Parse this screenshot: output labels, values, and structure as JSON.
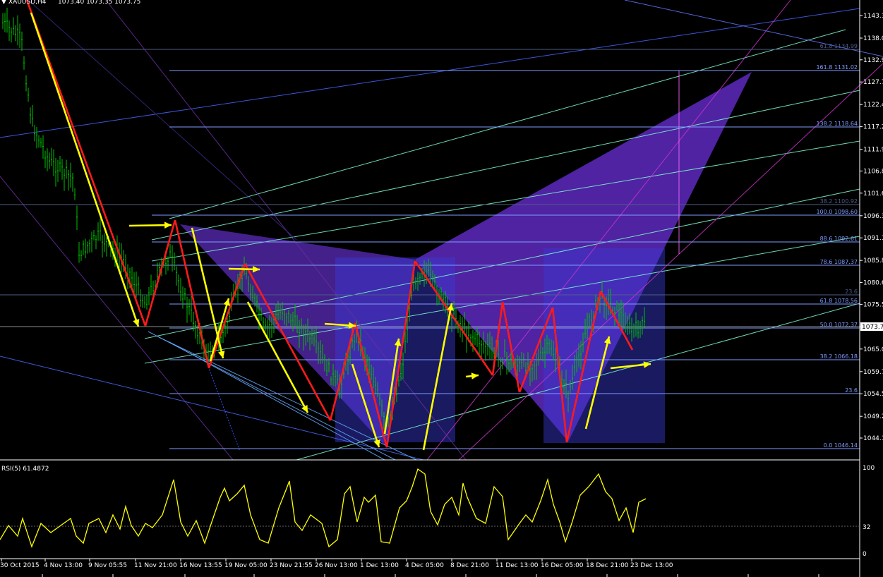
{
  "header": {
    "symbol": "XAUUSD,H4",
    "ohlc": "1073.40 1073.35 1073.75"
  },
  "price_axis": {
    "labels": [
      "1143.3",
      "1138.0",
      "1132.9",
      "1127.7",
      "1122.4",
      "1117.2",
      "1111.9",
      "1106.8",
      "1101.6",
      "1096.3",
      "1091.1",
      "1085.8",
      "1080.6",
      "1075.5",
      "1070.2",
      "1065.0",
      "1059.7",
      "1054.5",
      "1049.2",
      "1044.1"
    ],
    "current_price": "1073.7"
  },
  "fib_levels": [
    {
      "label": "61.8  1134.99",
      "color": "#4e5e88"
    },
    {
      "label": "161.8  1131.02",
      "color": "#7f9cff"
    },
    {
      "label": "138.2  1118.64",
      "color": "#7f9cff"
    },
    {
      "label": "38.2  1100.92",
      "color": "#4e5e88"
    },
    {
      "label": "100.0  1098.60",
      "color": "#7f9cff"
    },
    {
      "label": "88.6  1092.61",
      "color": "#7f9cff"
    },
    {
      "label": "78.6  1087.37",
      "color": "#7f9cff"
    },
    {
      "label": "23.6",
      "color": "#4e5e88"
    },
    {
      "label": "61.8  1078.56",
      "color": "#7f9cff"
    },
    {
      "label": "50.0  1072.37",
      "color": "#7f9cff"
    },
    {
      "label": "38.2  1066.18",
      "color": "#7f9cff"
    },
    {
      "label": "23.6",
      "color": "#7f9cff"
    },
    {
      "label": "0.0  1046.14",
      "color": "#7f9cff"
    }
  ],
  "rsi": {
    "label": "RSI(5) 61.4872",
    "levels": [
      "100",
      "32",
      "0"
    ]
  },
  "time_axis": {
    "labels": [
      "30 Oct 2015",
      "4 Nov 13:00",
      "9 Nov 05:55",
      "11 Nov 21:00",
      "16 Nov 13:55",
      "19 Nov 05:00",
      "23 Nov 21:55",
      "26 Nov 13:00",
      "1 Dec 13:00",
      "4 Dec 05:00",
      "8 Dec 21:00",
      "11 Dec 13:00",
      "16 Dec 05:00",
      "18 Dec 21:00",
      "23 Dec 13:00"
    ]
  },
  "colors": {
    "background": "#000000",
    "candles": "#00c000",
    "zigzag": "#ff1a1a",
    "arrows": "#ffff00",
    "rsi": "#ffff00",
    "pattern_fill": "#6a2fd8",
    "channel": "#7fffd4",
    "fib": "#7f9cff",
    "trendline": "#cc33cc"
  },
  "chart_data": {
    "type": "candlestick",
    "title": "XAUUSD,H4",
    "ylim": [
      1043,
      1146
    ],
    "close_path": [
      {
        "x": "30 Oct 2015",
        "y": 1146
      },
      {
        "x": "4 Nov 13:00",
        "y": 1108
      },
      {
        "x": "9 Nov 05:55",
        "y": 1090
      },
      {
        "x": "11 Nov 21:00",
        "y": 1080
      },
      {
        "x": "16 Nov 13:55",
        "y": 1082
      },
      {
        "x": "19 Nov 05:00",
        "y": 1078
      },
      {
        "x": "23 Nov 21:55",
        "y": 1074
      },
      {
        "x": "26 Nov 13:00",
        "y": 1068
      },
      {
        "x": "1 Dec 13:00",
        "y": 1059
      },
      {
        "x": "4 Dec 05:00",
        "y": 1084
      },
      {
        "x": "8 Dec 21:00",
        "y": 1072
      },
      {
        "x": "11 Dec 13:00",
        "y": 1063
      },
      {
        "x": "16 Dec 05:00",
        "y": 1063
      },
      {
        "x": "18 Dec 21:00",
        "y": 1077
      },
      {
        "x": "23 Dec 13:00",
        "y": 1073.7
      }
    ],
    "zigzag_points": [
      {
        "x": "30 Oct 2015",
        "y": 1146
      },
      {
        "x": "11 Nov 21:00",
        "y": 1074
      },
      {
        "x": "16 Nov 13:55",
        "y": 1098
      },
      {
        "x": "19 Nov 05:00",
        "y": 1064
      },
      {
        "x": "19 Nov 05:00",
        "y": 1087.5
      },
      {
        "x": "26 Nov 13:00",
        "y": 1052.5
      },
      {
        "x": "1 Dec 13:00",
        "y": 1073
      },
      {
        "x": "1 Dec 13:00",
        "y": 1046.5
      },
      {
        "x": "4 Dec 05:00",
        "y": 1088
      },
      {
        "x": "11 Dec 13:00",
        "y": 1061
      },
      {
        "x": "11 Dec 13:00",
        "y": 1079
      },
      {
        "x": "16 Dec 05:00",
        "y": 1058
      },
      {
        "x": "16 Dec 05:00",
        "y": 1078
      },
      {
        "x": "16 Dec 05:00",
        "y": 1047.5
      },
      {
        "x": "18 Dec 21:00",
        "y": 1081.5
      },
      {
        "x": "23 Dec 13:00",
        "y": 1068.5
      }
    ],
    "rsi_levels": [
      100,
      32,
      0
    ],
    "rsi_last": 61.4872
  }
}
